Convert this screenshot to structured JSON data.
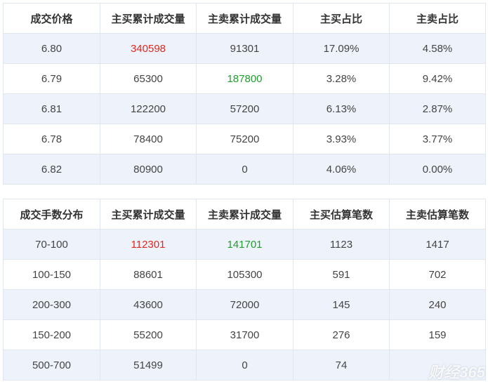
{
  "price_table": {
    "headers": [
      "成交价格",
      "主买累计成交量",
      "主卖累计成交量",
      "主买占比",
      "主卖占比"
    ],
    "rows": [
      [
        "6.80",
        "340598",
        "91301",
        "17.09%",
        "4.58%"
      ],
      [
        "6.79",
        "65300",
        "187800",
        "3.28%",
        "9.42%"
      ],
      [
        "6.81",
        "122200",
        "57200",
        "6.13%",
        "2.87%"
      ],
      [
        "6.78",
        "78400",
        "75200",
        "3.93%",
        "3.77%"
      ],
      [
        "6.82",
        "80900",
        "0",
        "4.06%",
        "0.00%"
      ]
    ]
  },
  "lot_table": {
    "headers": [
      "成交手数分布",
      "主买累计成交量",
      "主卖累计成交量",
      "主买估算笔数",
      "主卖估算笔数"
    ],
    "rows": [
      [
        "70-100",
        "112301",
        "141701",
        "1123",
        "1417"
      ],
      [
        "100-150",
        "88601",
        "105300",
        "591",
        "702"
      ],
      [
        "200-300",
        "43600",
        "72000",
        "145",
        "240"
      ],
      [
        "150-200",
        "55200",
        "31700",
        "276",
        "159"
      ],
      [
        "500-700",
        "51499",
        "0",
        "74",
        ""
      ]
    ]
  },
  "colors": {
    "highlight_buy": "#e0281f",
    "highlight_sell": "#1f9e2c",
    "row_stripe": "#eef3fb"
  },
  "watermark": {
    "text": "财经365"
  }
}
